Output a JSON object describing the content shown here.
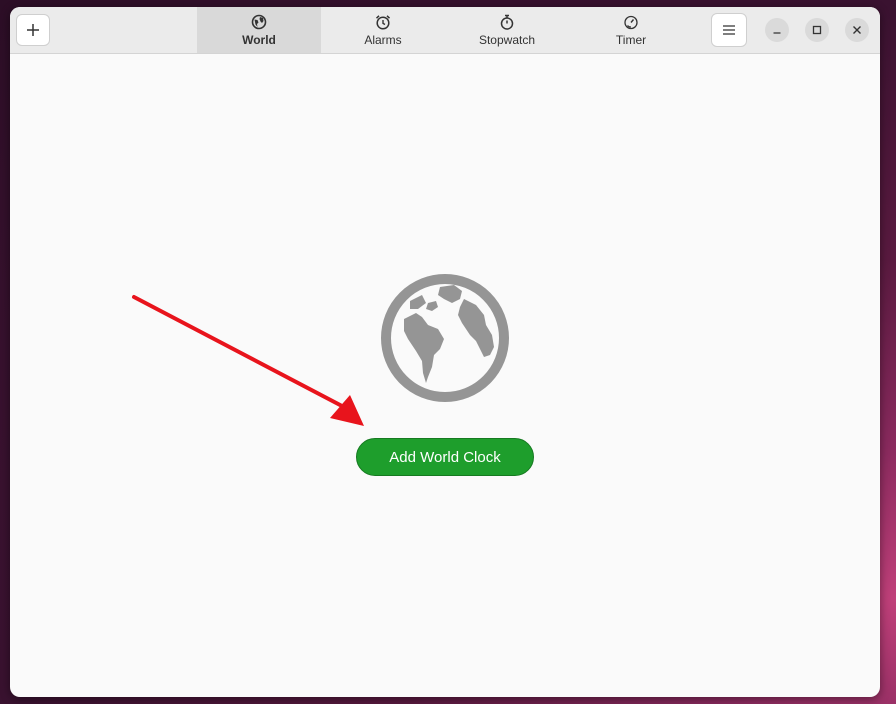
{
  "header": {
    "add_icon": "plus-icon",
    "menu_icon": "hamburger-menu-icon",
    "tabs": [
      {
        "label": "World",
        "icon": "globe-icon",
        "active": true
      },
      {
        "label": "Alarms",
        "icon": "alarm-clock-icon",
        "active": false
      },
      {
        "label": "Stopwatch",
        "icon": "stopwatch-icon",
        "active": false
      },
      {
        "label": "Timer",
        "icon": "timer-icon",
        "active": false
      }
    ]
  },
  "main": {
    "empty_icon": "globe-icon",
    "add_button_label": "Add World Clock"
  },
  "annotation": {
    "type": "arrow",
    "color": "#e8141c"
  },
  "colors": {
    "accent": "#1e9e2c",
    "icon_gray": "#959595"
  }
}
